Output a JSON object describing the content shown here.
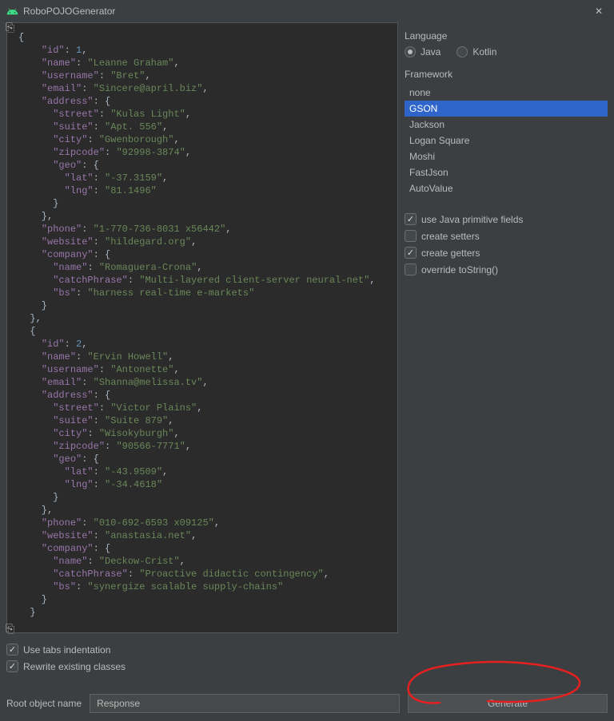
{
  "titlebar": {
    "title": "RoboPOJOGenerator"
  },
  "editor_tokens": [
    [
      [
        "p",
        "{"
      ]
    ],
    [
      [
        "p",
        "    "
      ],
      [
        "k",
        "\"id\""
      ],
      [
        "p",
        ": "
      ],
      [
        "n",
        "1"
      ],
      [
        "p",
        ","
      ]
    ],
    [
      [
        "p",
        "    "
      ],
      [
        "k",
        "\"name\""
      ],
      [
        "p",
        ": "
      ],
      [
        "s",
        "\"Leanne Graham\""
      ],
      [
        "p",
        ","
      ]
    ],
    [
      [
        "p",
        "    "
      ],
      [
        "k",
        "\"username\""
      ],
      [
        "p",
        ": "
      ],
      [
        "s",
        "\"Bret\""
      ],
      [
        "p",
        ","
      ]
    ],
    [
      [
        "p",
        "    "
      ],
      [
        "k",
        "\"email\""
      ],
      [
        "p",
        ": "
      ],
      [
        "s",
        "\"Sincere@april.biz\""
      ],
      [
        "p",
        ","
      ]
    ],
    [
      [
        "p",
        "    "
      ],
      [
        "k",
        "\"address\""
      ],
      [
        "p",
        ": {"
      ]
    ],
    [
      [
        "p",
        "      "
      ],
      [
        "k",
        "\"street\""
      ],
      [
        "p",
        ": "
      ],
      [
        "s",
        "\"Kulas Light\""
      ],
      [
        "p",
        ","
      ]
    ],
    [
      [
        "p",
        "      "
      ],
      [
        "k",
        "\"suite\""
      ],
      [
        "p",
        ": "
      ],
      [
        "s",
        "\"Apt. 556\""
      ],
      [
        "p",
        ","
      ]
    ],
    [
      [
        "p",
        "      "
      ],
      [
        "k",
        "\"city\""
      ],
      [
        "p",
        ": "
      ],
      [
        "s",
        "\"Gwenborough\""
      ],
      [
        "p",
        ","
      ]
    ],
    [
      [
        "p",
        "      "
      ],
      [
        "k",
        "\"zipcode\""
      ],
      [
        "p",
        ": "
      ],
      [
        "s",
        "\"92998-3874\""
      ],
      [
        "p",
        ","
      ]
    ],
    [
      [
        "p",
        "      "
      ],
      [
        "k",
        "\"geo\""
      ],
      [
        "p",
        ": {"
      ]
    ],
    [
      [
        "p",
        "        "
      ],
      [
        "k",
        "\"lat\""
      ],
      [
        "p",
        ": "
      ],
      [
        "s",
        "\"-37.3159\""
      ],
      [
        "p",
        ","
      ]
    ],
    [
      [
        "p",
        "        "
      ],
      [
        "k",
        "\"lng\""
      ],
      [
        "p",
        ": "
      ],
      [
        "s",
        "\"81.1496\""
      ]
    ],
    [
      [
        "p",
        "      }"
      ]
    ],
    [
      [
        "p",
        "    },"
      ]
    ],
    [
      [
        "p",
        "    "
      ],
      [
        "k",
        "\"phone\""
      ],
      [
        "p",
        ": "
      ],
      [
        "s",
        "\"1-770-736-8031 x56442\""
      ],
      [
        "p",
        ","
      ]
    ],
    [
      [
        "p",
        "    "
      ],
      [
        "k",
        "\"website\""
      ],
      [
        "p",
        ": "
      ],
      [
        "s",
        "\"hildegard.org\""
      ],
      [
        "p",
        ","
      ]
    ],
    [
      [
        "p",
        "    "
      ],
      [
        "k",
        "\"company\""
      ],
      [
        "p",
        ": {"
      ]
    ],
    [
      [
        "p",
        "      "
      ],
      [
        "k",
        "\"name\""
      ],
      [
        "p",
        ": "
      ],
      [
        "s",
        "\"Romaguera-Crona\""
      ],
      [
        "p",
        ","
      ]
    ],
    [
      [
        "p",
        "      "
      ],
      [
        "k",
        "\"catchPhrase\""
      ],
      [
        "p",
        ": "
      ],
      [
        "s",
        "\"Multi-layered client-server neural-net\""
      ],
      [
        "p",
        ","
      ]
    ],
    [
      [
        "p",
        "      "
      ],
      [
        "k",
        "\"bs\""
      ],
      [
        "p",
        ": "
      ],
      [
        "s",
        "\"harness real-time e-markets\""
      ]
    ],
    [
      [
        "p",
        "    }"
      ]
    ],
    [
      [
        "p",
        "  },"
      ]
    ],
    [
      [
        "p",
        "  {"
      ]
    ],
    [
      [
        "p",
        "    "
      ],
      [
        "k",
        "\"id\""
      ],
      [
        "p",
        ": "
      ],
      [
        "n",
        "2"
      ],
      [
        "p",
        ","
      ]
    ],
    [
      [
        "p",
        "    "
      ],
      [
        "k",
        "\"name\""
      ],
      [
        "p",
        ": "
      ],
      [
        "s",
        "\"Ervin Howell\""
      ],
      [
        "p",
        ","
      ]
    ],
    [
      [
        "p",
        "    "
      ],
      [
        "k",
        "\"username\""
      ],
      [
        "p",
        ": "
      ],
      [
        "s",
        "\"Antonette\""
      ],
      [
        "p",
        ","
      ]
    ],
    [
      [
        "p",
        "    "
      ],
      [
        "k",
        "\"email\""
      ],
      [
        "p",
        ": "
      ],
      [
        "s",
        "\"Shanna@melissa.tv\""
      ],
      [
        "p",
        ","
      ]
    ],
    [
      [
        "p",
        "    "
      ],
      [
        "k",
        "\"address\""
      ],
      [
        "p",
        ": {"
      ]
    ],
    [
      [
        "p",
        "      "
      ],
      [
        "k",
        "\"street\""
      ],
      [
        "p",
        ": "
      ],
      [
        "s",
        "\"Victor Plains\""
      ],
      [
        "p",
        ","
      ]
    ],
    [
      [
        "p",
        "      "
      ],
      [
        "k",
        "\"suite\""
      ],
      [
        "p",
        ": "
      ],
      [
        "s",
        "\"Suite 879\""
      ],
      [
        "p",
        ","
      ]
    ],
    [
      [
        "p",
        "      "
      ],
      [
        "k",
        "\"city\""
      ],
      [
        "p",
        ": "
      ],
      [
        "s",
        "\"Wisokyburgh\""
      ],
      [
        "p",
        ","
      ]
    ],
    [
      [
        "p",
        "      "
      ],
      [
        "k",
        "\"zipcode\""
      ],
      [
        "p",
        ": "
      ],
      [
        "s",
        "\"90566-7771\""
      ],
      [
        "p",
        ","
      ]
    ],
    [
      [
        "p",
        "      "
      ],
      [
        "k",
        "\"geo\""
      ],
      [
        "p",
        ": {"
      ]
    ],
    [
      [
        "p",
        "        "
      ],
      [
        "k",
        "\"lat\""
      ],
      [
        "p",
        ": "
      ],
      [
        "s",
        "\"-43.9509\""
      ],
      [
        "p",
        ","
      ]
    ],
    [
      [
        "p",
        "        "
      ],
      [
        "k",
        "\"lng\""
      ],
      [
        "p",
        ": "
      ],
      [
        "s",
        "\"-34.4618\""
      ]
    ],
    [
      [
        "p",
        "      }"
      ]
    ],
    [
      [
        "p",
        "    },"
      ]
    ],
    [
      [
        "p",
        "    "
      ],
      [
        "k",
        "\"phone\""
      ],
      [
        "p",
        ": "
      ],
      [
        "s",
        "\"010-692-6593 x09125\""
      ],
      [
        "p",
        ","
      ]
    ],
    [
      [
        "p",
        "    "
      ],
      [
        "k",
        "\"website\""
      ],
      [
        "p",
        ": "
      ],
      [
        "s",
        "\"anastasia.net\""
      ],
      [
        "p",
        ","
      ]
    ],
    [
      [
        "p",
        "    "
      ],
      [
        "k",
        "\"company\""
      ],
      [
        "p",
        ": {"
      ]
    ],
    [
      [
        "p",
        "      "
      ],
      [
        "k",
        "\"name\""
      ],
      [
        "p",
        ": "
      ],
      [
        "s",
        "\"Deckow-Crist\""
      ],
      [
        "p",
        ","
      ]
    ],
    [
      [
        "p",
        "      "
      ],
      [
        "k",
        "\"catchPhrase\""
      ],
      [
        "p",
        ": "
      ],
      [
        "s",
        "\"Proactive didactic contingency\""
      ],
      [
        "p",
        ","
      ]
    ],
    [
      [
        "p",
        "      "
      ],
      [
        "k",
        "\"bs\""
      ],
      [
        "p",
        ": "
      ],
      [
        "s",
        "\"synergize scalable supply-chains\""
      ]
    ],
    [
      [
        "p",
        "    }"
      ]
    ],
    [
      [
        "p",
        "  }"
      ]
    ]
  ],
  "left_options": {
    "tabs_indent": {
      "label": "Use tabs indentation",
      "checked": true
    },
    "rewrite": {
      "label": "Rewrite existing classes",
      "checked": true
    }
  },
  "right": {
    "language_label": "Language",
    "radios": {
      "java": "Java",
      "kotlin": "Kotlin",
      "selected": "java"
    },
    "framework_label": "Framework",
    "frameworks": [
      "none",
      "GSON",
      "Jackson",
      "Logan Square",
      "Moshi",
      "FastJson",
      "AutoValue"
    ],
    "framework_selected": "GSON",
    "checks": {
      "primitive": {
        "label": "use Java primitive fields",
        "checked": true
      },
      "setters": {
        "label": "create setters",
        "checked": false
      },
      "getters": {
        "label": "create getters",
        "checked": true
      },
      "tostring": {
        "label": "override toString()",
        "checked": false
      }
    }
  },
  "bottom": {
    "root_label": "Root object name",
    "root_value": "Response",
    "generate_label": "Generate"
  }
}
